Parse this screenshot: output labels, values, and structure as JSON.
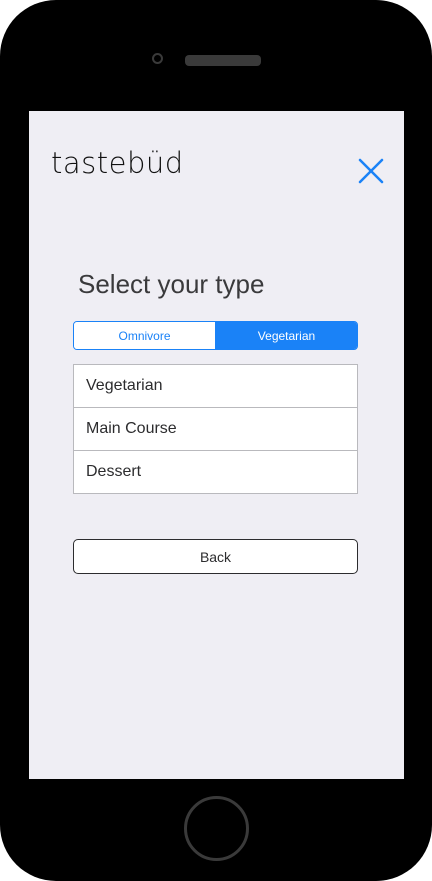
{
  "app": {
    "brand_name": "tastebüd"
  },
  "icons": {
    "close": "close-icon"
  },
  "colors": {
    "accent": "#1a82f7",
    "screen_background": "#efeef4",
    "device_frame": "#000000"
  },
  "main": {
    "title": "Select your type",
    "segmented_control": {
      "options": [
        "Omnivore",
        "Vegetarian"
      ],
      "selected": "Vegetarian"
    },
    "list": {
      "items": [
        "Vegetarian",
        "Main Course",
        "Dessert"
      ]
    },
    "back_button_label": "Back"
  }
}
